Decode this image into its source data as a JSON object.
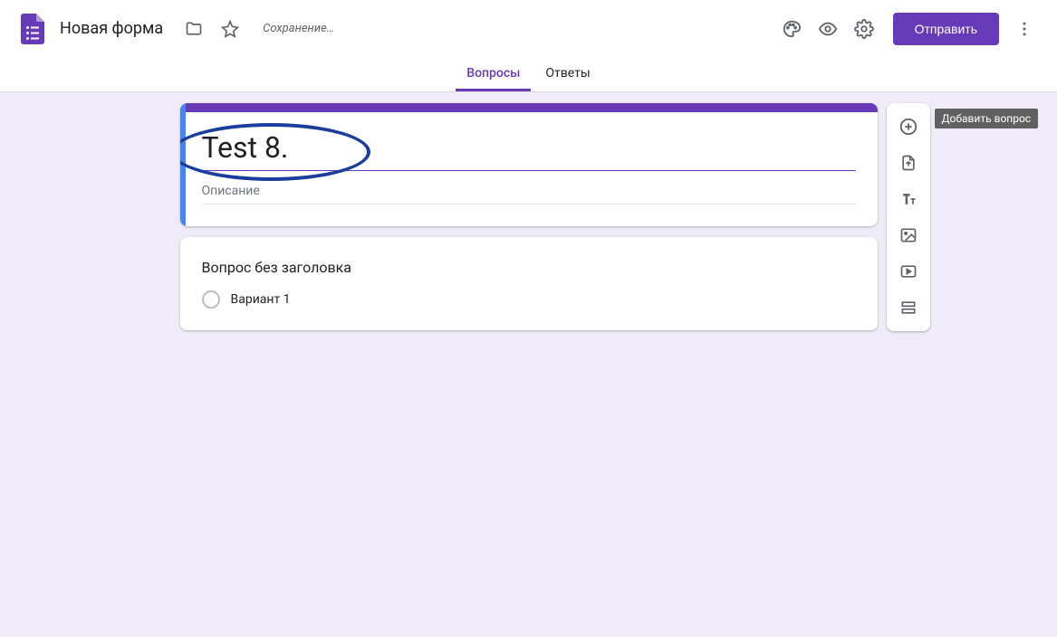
{
  "header": {
    "doc_title": "Новая форма",
    "save_status": "Сохранение…",
    "send_label": "Отправить"
  },
  "tabs": {
    "questions": "Вопросы",
    "responses": "Ответы"
  },
  "form": {
    "title_value": "Test 8.",
    "description_placeholder": "Описание"
  },
  "question": {
    "title": "Вопрос без заголовка",
    "option1": "Вариант 1"
  },
  "toolbar": {
    "add_question_tooltip": "Добавить вопрос"
  },
  "colors": {
    "accent": "#673ab7",
    "canvas_bg": "#f0ebf8",
    "selection_blue": "#4285f4"
  }
}
